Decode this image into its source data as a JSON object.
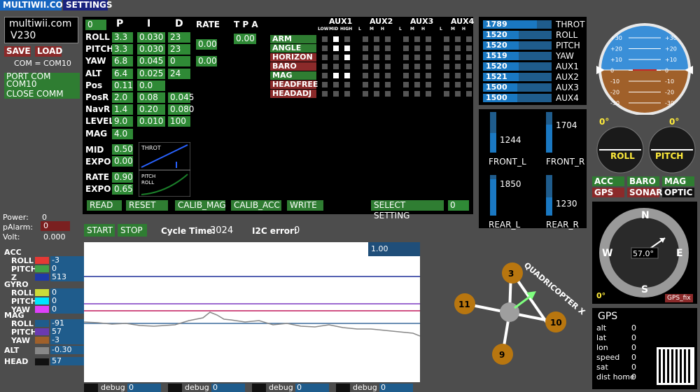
{
  "tabs": {
    "main": "MULTIWII.COM",
    "settings": "SETTINGS"
  },
  "brand": {
    "line1": "multiwii.com",
    "line2": "V230"
  },
  "conn": {
    "save": "SAVE",
    "load": "LOAD",
    "com": "COM = COM10",
    "port": "PORT COM",
    "port_value": "COM10",
    "close": "CLOSE COMM"
  },
  "pid": {
    "header_p": "P",
    "header_i": "I",
    "header_d": "D",
    "header_rate": "RATE",
    "header_tpa": "T P A",
    "top_value": "0",
    "rows": [
      {
        "name": "ROLL",
        "p": "3.3",
        "i": "0.030",
        "d": "23"
      },
      {
        "name": "PITCH",
        "p": "3.3",
        "i": "0.030",
        "d": "23"
      },
      {
        "name": "YAW",
        "p": "6.8",
        "i": "0.045",
        "d": "0"
      },
      {
        "name": "ALT",
        "p": "6.4",
        "i": "0.025",
        "d": "24"
      },
      {
        "name": "Pos",
        "p": "0.11",
        "i": "0.0",
        "d": ""
      },
      {
        "name": "PosR",
        "p": "2.0",
        "i": "0.08",
        "d": "0.045"
      },
      {
        "name": "NavR",
        "p": "1.4",
        "i": "0.20",
        "d": "0.080"
      },
      {
        "name": "LEVEL",
        "p": "9.0",
        "i": "0.010",
        "d": "100"
      },
      {
        "name": "MAG",
        "p": "4.0",
        "i": "",
        "d": ""
      }
    ],
    "rate1": "0.00",
    "rate2": "0.00",
    "tpa": "0.00",
    "mid_label": "MID",
    "mid": "0.50",
    "expo_label": "EXPO",
    "expo": "0.00",
    "throt_label": "THROT",
    "rate_label": "RATE",
    "rate": "0.90",
    "expo2_label": "EXPO",
    "expo2": "0.65",
    "pitch_roll_label1": "PITCH",
    "pitch_roll_label2": "ROLL"
  },
  "pid_buttons": {
    "read": "READ",
    "reset": "RESET",
    "calib_mag": "CALIB_MAG",
    "calib_acc": "CALIB_ACC",
    "write": "WRITE",
    "select": "SELECT SETTING",
    "select_value": "0"
  },
  "aux": {
    "headers": [
      "AUX1",
      "AUX2",
      "AUX3",
      "AUX4"
    ],
    "sub1": [
      "LOW",
      "MID",
      "HIGH"
    ],
    "sub": [
      "L",
      "M",
      "H"
    ],
    "modes": [
      {
        "name": "ARM",
        "color": "green",
        "on": [
          1
        ]
      },
      {
        "name": "ANGLE",
        "color": "green",
        "on": [
          1,
          2
        ]
      },
      {
        "name": "HORIZON",
        "color": "red",
        "on": [
          2
        ]
      },
      {
        "name": "BARO",
        "color": "red",
        "on": []
      },
      {
        "name": "MAG",
        "color": "green",
        "on": [
          1,
          2
        ]
      },
      {
        "name": "HEADFREE",
        "color": "red",
        "on": []
      },
      {
        "name": "HEADADJ",
        "color": "red",
        "on": []
      }
    ]
  },
  "rc": [
    {
      "name": "THROT",
      "value": "1789",
      "frac": 0.79
    },
    {
      "name": "ROLL",
      "value": "1520",
      "frac": 0.52
    },
    {
      "name": "PITCH",
      "value": "1520",
      "frac": 0.52
    },
    {
      "name": "YAW",
      "value": "1519",
      "frac": 0.52
    },
    {
      "name": "AUX1",
      "value": "1520",
      "frac": 0.52
    },
    {
      "name": "AUX2",
      "value": "1521",
      "frac": 0.52
    },
    {
      "name": "AUX3",
      "value": "1500",
      "frac": 0.5
    },
    {
      "name": "AUX4",
      "value": "1500",
      "frac": 0.5
    }
  ],
  "motors": {
    "front_l": {
      "label": "FRONT_L",
      "value": "1244"
    },
    "front_r": {
      "label": "FRONT_R",
      "value": "1704"
    },
    "rear_l": {
      "label": "REAR_L",
      "value": "1850"
    },
    "rear_r": {
      "label": "REAR_R",
      "value": "1230"
    }
  },
  "status": {
    "power_label": "Power:",
    "power": "0",
    "palarm_label": "pAlarm:",
    "palarm": "0",
    "volt_label": "Volt:",
    "volt": "0.000"
  },
  "sensors": {
    "acc": "ACC",
    "acc_roll": "ROLL",
    "acc_roll_v": "-3",
    "acc_pitch": "PITCH",
    "acc_pitch_v": "0",
    "acc_z": "Z",
    "acc_z_v": "513",
    "gyro": "GYRO",
    "gyro_roll": "ROLL",
    "gyro_roll_v": "0",
    "gyro_pitch": "PITCH",
    "gyro_pitch_v": "0",
    "gyro_yaw": "YAW",
    "gyro_yaw_v": "0",
    "mag": "MAG",
    "mag_roll": "ROLL",
    "mag_roll_v": "-91",
    "mag_pitch": "PITCH",
    "mag_pitch_v": "57",
    "mag_yaw": "YAW",
    "mag_yaw_v": "-3",
    "alt": "ALT",
    "alt_v": "-0.30",
    "head": "HEAD",
    "head_v": "57"
  },
  "graph": {
    "start": "START",
    "stop": "STOP",
    "cycle_label": "Cycle Time:",
    "cycle": "3024",
    "i2c_label": "I2C error:",
    "i2c": "0",
    "scale": "1.00"
  },
  "debug": [
    {
      "label": "debug",
      "value": "0"
    },
    {
      "label": "debug",
      "value": "0"
    },
    {
      "label": "debug",
      "value": "0"
    },
    {
      "label": "debug",
      "value": "0"
    }
  ],
  "quad": {
    "label": "QUADRICOPTER X",
    "m3": "3",
    "m11": "11",
    "m10": "10",
    "m9": "9"
  },
  "horizon": {
    "ticks_left": [
      "+30",
      "+20",
      "+10",
      "0",
      "-10",
      "-20",
      "-30"
    ],
    "ticks_right": [
      "+30",
      "+20",
      "+10",
      "0",
      "-10",
      "-20",
      "-30"
    ],
    "roll_deg": "0°",
    "pitch_deg": "0°",
    "roll": "ROLL",
    "pitch": "PITCH"
  },
  "flags": {
    "acc": "ACC",
    "baro": "BARO",
    "mag": "MAG",
    "gps": "GPS",
    "sonar": "SONAR",
    "optic": "OPTIC"
  },
  "compass": {
    "n": "N",
    "s": "S",
    "e": "E",
    "w": "W",
    "heading": "57.0°",
    "zero": "0°",
    "gps_fix": "GPS_fix"
  },
  "gps": {
    "title": "GPS",
    "rows": [
      {
        "k": "alt",
        "v": "0"
      },
      {
        "k": "lat",
        "v": "0"
      },
      {
        "k": "lon",
        "v": "0"
      },
      {
        "k": "speed",
        "v": "0"
      },
      {
        "k": "sat",
        "v": "0"
      },
      {
        "k": "dist home",
        "v": "0"
      }
    ]
  }
}
